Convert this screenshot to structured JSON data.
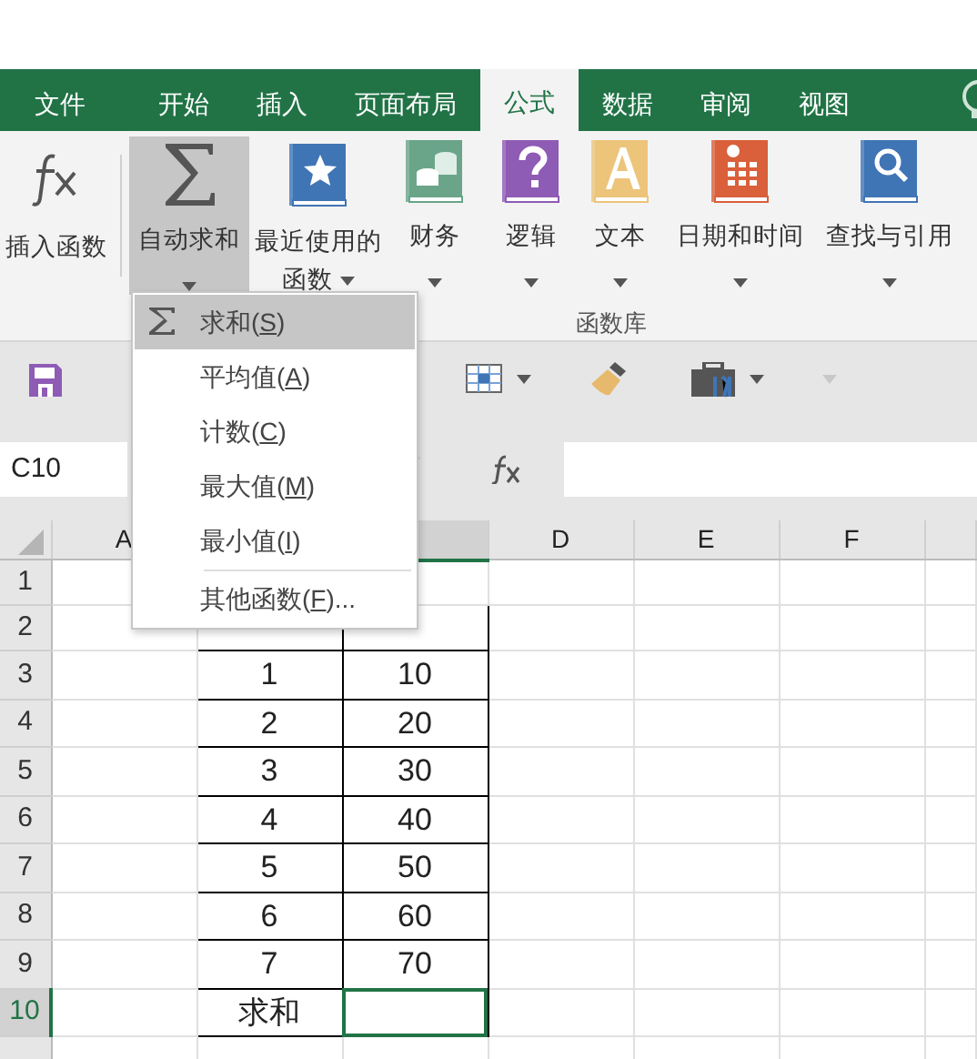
{
  "tabs": [
    {
      "label": "文件",
      "selected": false
    },
    {
      "label": "开始",
      "selected": false
    },
    {
      "label": "插入",
      "selected": false
    },
    {
      "label": "页面布局",
      "selected": false
    },
    {
      "label": "公式",
      "selected": true
    },
    {
      "label": "数据",
      "selected": false
    },
    {
      "label": "审阅",
      "selected": false
    },
    {
      "label": "视图",
      "selected": false
    }
  ],
  "ribbon": {
    "group_label": "函数库",
    "buttons": [
      {
        "kind": "fx",
        "lines": [
          "插入函数"
        ],
        "selected": false,
        "dropdown": false
      },
      {
        "kind": "sigma",
        "lines": [
          "自动求和"
        ],
        "selected": true,
        "dropdown": true
      },
      {
        "kind": "recent",
        "lines": [
          "最近使用的",
          "函数"
        ],
        "selected": false,
        "dropdown": true
      },
      {
        "kind": "finance",
        "lines": [
          "财务"
        ],
        "selected": false,
        "dropdown": true
      },
      {
        "kind": "logic",
        "lines": [
          "逻辑"
        ],
        "selected": false,
        "dropdown": true
      },
      {
        "kind": "text",
        "lines": [
          "文本"
        ],
        "selected": false,
        "dropdown": true
      },
      {
        "kind": "date",
        "lines": [
          "日期和时间"
        ],
        "selected": false,
        "dropdown": true
      },
      {
        "kind": "lookup",
        "lines": [
          "查找与引用"
        ],
        "selected": false,
        "dropdown": true
      }
    ]
  },
  "autosum_menu": [
    {
      "before": "求和(",
      "key": "S",
      "after": ")",
      "selected": true,
      "kind": "sigma"
    },
    {
      "before": "平均值(",
      "key": "A",
      "after": ")",
      "selected": false,
      "kind": "plain"
    },
    {
      "before": "计数(",
      "key": "C",
      "after": ")",
      "selected": false,
      "kind": "plain"
    },
    {
      "before": "最大值(",
      "key": "M",
      "after": ")",
      "selected": false,
      "kind": "plain"
    },
    {
      "before": "最小值(",
      "key": "I",
      "after": ")",
      "selected": false,
      "kind": "plain"
    },
    {
      "before": "其他函数(",
      "key": "F",
      "after": ")...",
      "selected": false,
      "kind": "more"
    }
  ],
  "name_box": "C10",
  "sheet": {
    "columns": [
      {
        "label": "A",
        "selected": false
      },
      {
        "selected": true
      },
      {
        "label": "D",
        "selected": false
      },
      {
        "label": "E",
        "selected": false
      },
      {
        "label": "F",
        "selected": false
      }
    ],
    "rows": [
      {
        "header": "1",
        "selected": false,
        "cells": []
      },
      {
        "header": "2",
        "selected": false,
        "cells": [
          {
            "selected": false
          },
          {
            "selected": false
          }
        ]
      },
      {
        "header": "3",
        "selected": false,
        "cells": [
          {
            "text": "1",
            "selected": false
          },
          {
            "text": "10",
            "selected": false
          }
        ]
      },
      {
        "header": "4",
        "selected": false,
        "cells": [
          {
            "text": "2",
            "selected": false
          },
          {
            "text": "20",
            "selected": false
          }
        ]
      },
      {
        "header": "5",
        "selected": false,
        "cells": [
          {
            "text": "3",
            "selected": false
          },
          {
            "text": "30",
            "selected": false
          }
        ]
      },
      {
        "header": "6",
        "selected": false,
        "cells": [
          {
            "text": "4",
            "selected": false
          },
          {
            "text": "40",
            "selected": false
          }
        ]
      },
      {
        "header": "7",
        "selected": false,
        "cells": [
          {
            "text": "5",
            "selected": false
          },
          {
            "text": "50",
            "selected": false
          }
        ]
      },
      {
        "header": "8",
        "selected": false,
        "cells": [
          {
            "text": "6",
            "selected": false
          },
          {
            "text": "60",
            "selected": false
          }
        ]
      },
      {
        "header": "9",
        "selected": false,
        "cells": [
          {
            "text": "7",
            "selected": false
          },
          {
            "text": "70",
            "selected": false
          }
        ]
      },
      {
        "header": "10",
        "selected": true,
        "cells": [
          {
            "text": "求和",
            "selected": false
          },
          {
            "selected": true
          }
        ]
      }
    ]
  }
}
